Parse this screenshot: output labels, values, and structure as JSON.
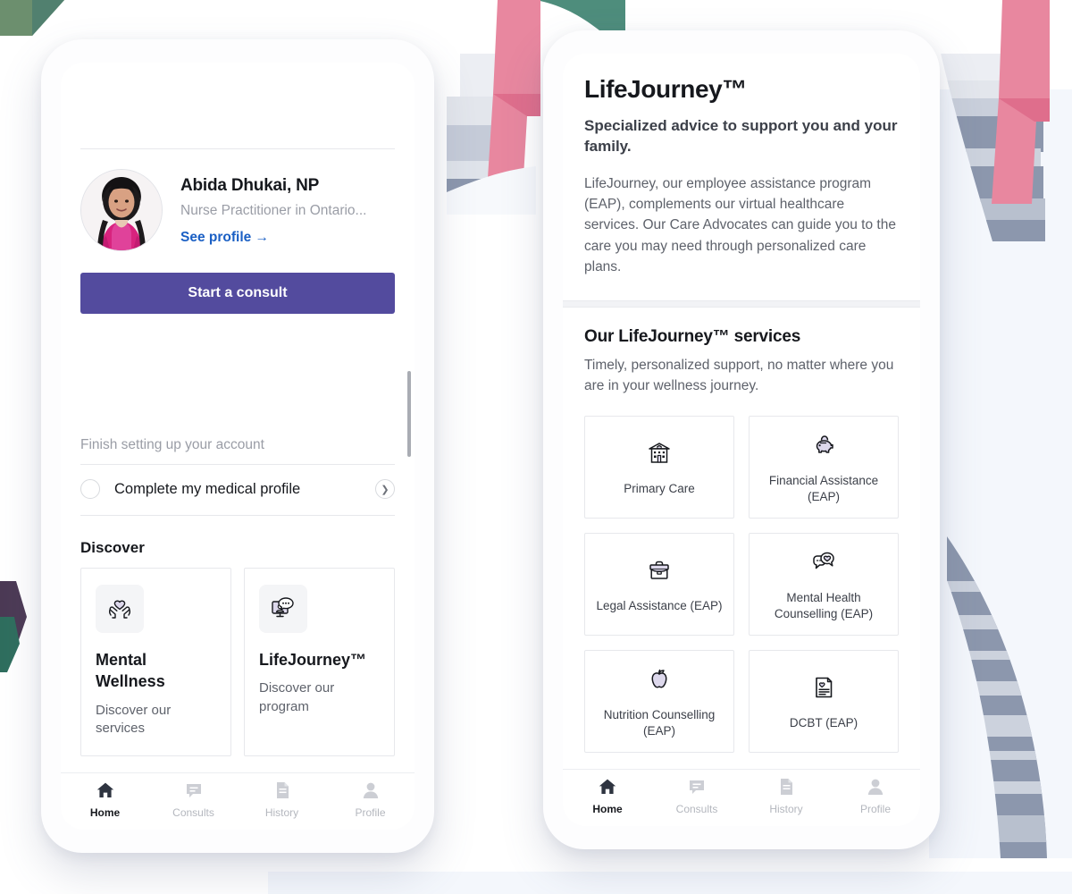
{
  "colors": {
    "primary_purple": "#534b9e",
    "link_blue": "#1a5fc4",
    "icon_lilac": "#ddd8ec",
    "text_dark": "#16181d",
    "text_muted": "#9a9da6",
    "bg_green": "#6c8f6e",
    "bg_teal": "#4e8d7c",
    "bg_pink": "#e8879f",
    "bg_slate": "#8c97ad",
    "bg_plum": "#4c3a55"
  },
  "left_phone": {
    "provider": {
      "name": "Abida Dhukai, NP",
      "role": "Nurse Practitioner in Ontario...",
      "link": "See profile →",
      "avatar_icon": "provider-photo"
    },
    "start_consult_label": "Start a consult",
    "finish_section": {
      "heading": "Finish setting up your account",
      "task_label": "Complete my medical profile",
      "radio_icon": "radio-unchecked-icon",
      "chevron_icon": "chevron-right-icon"
    },
    "discover": {
      "heading": "Discover",
      "cards": [
        {
          "icon": "heart-in-hands-icon",
          "title": "Mental Wellness",
          "sub": "Discover our services"
        },
        {
          "icon": "video-chat-icon",
          "title": "LifeJourney™",
          "sub": "Discover our program"
        }
      ]
    },
    "tabs": [
      {
        "label": "Home",
        "icon": "home-icon",
        "active": true
      },
      {
        "label": "Consults",
        "icon": "chat-icon",
        "active": false
      },
      {
        "label": "History",
        "icon": "document-icon",
        "active": false
      },
      {
        "label": "Profile",
        "icon": "person-icon",
        "active": false
      }
    ]
  },
  "right_phone": {
    "hero": {
      "title": "LifeJourney™",
      "subtitle": "Specialized advice to support you and your family.",
      "body": "LifeJourney, our employee assistance program (EAP), complements our virtual healthcare services. Our Care Advocates can guide you to the care you may need through personalized care plans."
    },
    "services_section": {
      "heading": "Our LifeJourney™ services",
      "subheading": "Timely, personalized support, no matter where you are in your wellness journey.",
      "items": [
        {
          "label": "Primary Care",
          "icon": "clinic-building-icon"
        },
        {
          "label": "Financial Assistance (EAP)",
          "icon": "piggy-bank-icon"
        },
        {
          "label": "Legal Assistance (EAP)",
          "icon": "briefcase-icon"
        },
        {
          "label": "Mental Health Counselling (EAP)",
          "icon": "chat-heart-icon"
        },
        {
          "label": "Nutrition Counselling (EAP)",
          "icon": "apple-icon"
        },
        {
          "label": "DCBT (EAP)",
          "icon": "document-heart-icon"
        }
      ]
    },
    "tabs": [
      {
        "label": "Home",
        "icon": "home-icon",
        "active": true
      },
      {
        "label": "Consults",
        "icon": "chat-icon",
        "active": false
      },
      {
        "label": "History",
        "icon": "document-icon",
        "active": false
      },
      {
        "label": "Profile",
        "icon": "person-icon",
        "active": false
      }
    ]
  }
}
